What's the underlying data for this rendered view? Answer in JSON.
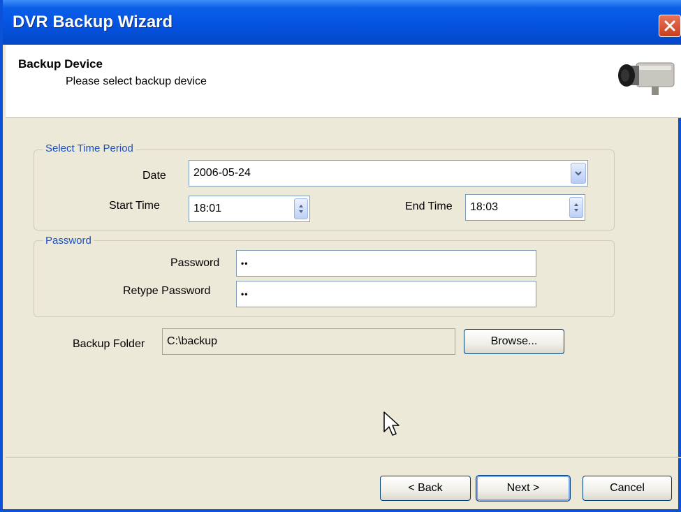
{
  "window": {
    "title": "DVR Backup Wizard"
  },
  "header": {
    "title": "Backup Device",
    "subtitle": "Please select backup device"
  },
  "time_period": {
    "group_label": "Select Time Period",
    "date_label": "Date",
    "date_value": "2006-05-24",
    "start_label": "Start Time",
    "start_value": "18:01",
    "end_label": "End Time",
    "end_value": "18:03"
  },
  "password": {
    "group_label": "Password",
    "password_label": "Password",
    "password_value": "••",
    "retype_label": "Retype Password",
    "retype_value": "••"
  },
  "backup_folder": {
    "label": "Backup Folder",
    "value": "C:\\backup",
    "browse_label": "Browse..."
  },
  "buttons": {
    "back": "< Back",
    "next": "Next >",
    "cancel": "Cancel"
  },
  "colors": {
    "titlebar": "#0553e0",
    "dialog_bg": "#ece9d8",
    "group_label": "#1c4fc2",
    "close": "#c8401d"
  },
  "icons": {
    "close": "close-icon",
    "camera": "camera-icon",
    "spinner": "spinner-icon",
    "dropdown": "chevron-down-icon",
    "cursor": "mouse-cursor-icon"
  }
}
